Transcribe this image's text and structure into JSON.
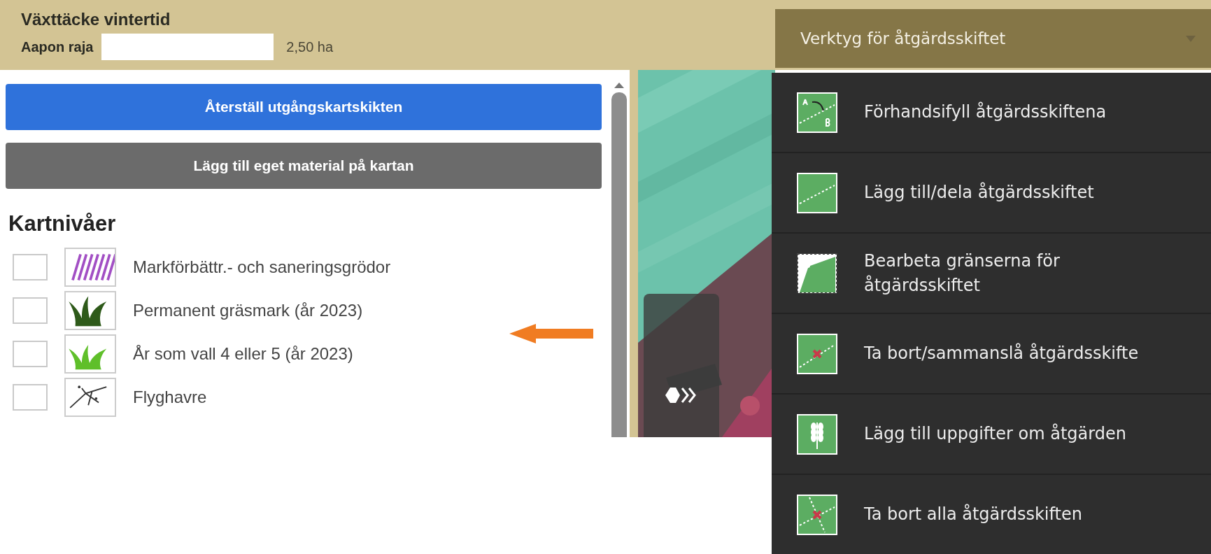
{
  "header": {
    "title": "Växttäcke vintertid",
    "field_label": "Aapon raja",
    "area": "2,50 ha"
  },
  "tools_dropdown": {
    "label": "Verktyg för åtgärdsskiftet",
    "expanded": true
  },
  "layer_panel": {
    "buttons": [
      {
        "label": "Återställ utgångskartskikten",
        "kind": "primary"
      },
      {
        "label": "Lägg till eget material på kartan",
        "kind": "secondary"
      }
    ],
    "heading": "Kartnivåer",
    "layers": [
      {
        "label": "Markförbättr.- och saneringsgrödor",
        "kind": "hatch",
        "checked": false
      },
      {
        "label": "Permanent gräsmark (år 2023)",
        "kind": "grass",
        "checked": false
      },
      {
        "label": "År som vall 4 eller 5 (år 2023)",
        "kind": "ley",
        "checked": false
      },
      {
        "label": "Flyghavre",
        "kind": "weed",
        "checked": false
      }
    ]
  },
  "tools_menu": [
    {
      "label": "Förhandsifyll åtgärdsskiftena",
      "kind": "prefill"
    },
    {
      "label": "Lägg till/dela åtgärdsskiftet",
      "kind": "split"
    },
    {
      "label": "Bearbeta gränserna för åtgärdsskiftet",
      "kind": "edit"
    },
    {
      "label": "Ta bort/sammanslå åtgärdsskifte",
      "kind": "merge"
    },
    {
      "label": "Lägg till uppgifter om åtgärden",
      "kind": "details"
    },
    {
      "label": "Ta bort alla åtgärdsskiften",
      "kind": "clear"
    }
  ]
}
